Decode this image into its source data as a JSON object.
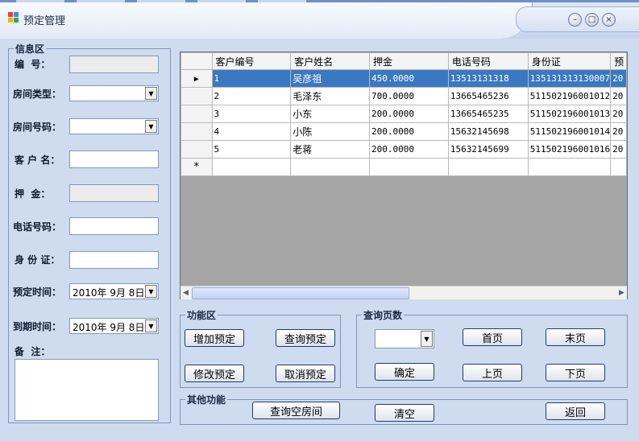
{
  "window": {
    "title": "预定管理",
    "controls": {
      "minimize": "–",
      "maximize": "□",
      "close": "×"
    }
  },
  "info_section": {
    "legend": "信息区",
    "labels": {
      "id": "编  号：",
      "room_type": "房间类型：",
      "room_number": "房间号码：",
      "customer_name": "客 户 名：",
      "deposit": "押  金：",
      "phone": "电话号码：",
      "id_card": "身 份 证：",
      "reserve_time": "预定时间：",
      "expire_time": "到期时间：",
      "note": "备  注："
    },
    "reserve_date": "2010年 9月 8日",
    "expire_date": "2010年 9月 8日"
  },
  "grid": {
    "columns": [
      "客户编号",
      "客户姓名",
      "押金",
      "电话号码",
      "身份证",
      "预"
    ],
    "rows": [
      [
        "1",
        "吴彦祖",
        "450.0000",
        "13513131318",
        "135131313130007",
        "20"
      ],
      [
        "2",
        "毛泽东",
        "700.0000",
        "13665465236",
        "511502196001012",
        "20"
      ],
      [
        "3",
        "小东",
        "200.0000",
        "13665465235",
        "511502196001013",
        "20"
      ],
      [
        "4",
        "小陈",
        "200.0000",
        "15632145698",
        "511502196001014",
        "20"
      ],
      [
        "5",
        "老蒋",
        "200.0000",
        "15632145699",
        "511502196001016",
        "20"
      ]
    ],
    "current_row_marker": "▶",
    "new_row_marker": "*"
  },
  "function_section": {
    "legend": "功能区",
    "add": "增加预定",
    "query": "查询预定",
    "modify": "修改预定",
    "cancel": "取消预定"
  },
  "page_section": {
    "legend": "查询页数",
    "confirm": "确定",
    "first": "首页",
    "last": "末页",
    "prev": "上页",
    "next": "下页"
  },
  "other_section": {
    "legend": "其他功能",
    "query_empty_rooms": "查询空房间",
    "clear": "清空",
    "back": "返回"
  },
  "colors": {
    "selection": "#3b78c2",
    "form_background": "#cfdbee",
    "grid_empty_area": "#a5a5a5"
  }
}
